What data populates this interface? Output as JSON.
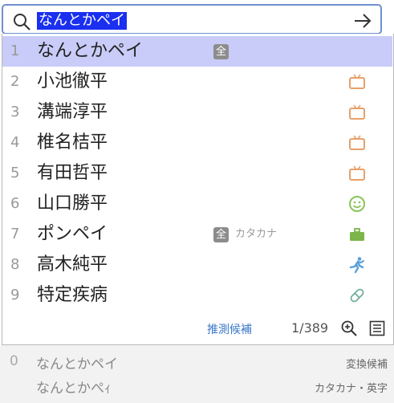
{
  "search": {
    "query": "なんとかペイ"
  },
  "candidates": [
    {
      "num": "1",
      "word": "なんとかペイ",
      "badge": "全",
      "icon": "full-width-badge"
    },
    {
      "num": "2",
      "word": "小池徹平",
      "icon": "tv-icon"
    },
    {
      "num": "3",
      "word": "溝端淳平",
      "icon": "tv-icon"
    },
    {
      "num": "4",
      "word": "椎名桔平",
      "icon": "tv-icon"
    },
    {
      "num": "5",
      "word": "有田哲平",
      "icon": "tv-icon"
    },
    {
      "num": "6",
      "word": "山口勝平",
      "icon": "smiley-icon"
    },
    {
      "num": "7",
      "word": "ポンペイ",
      "badge": "全",
      "note": "カタカナ",
      "icon": "briefcase-icon"
    },
    {
      "num": "8",
      "word": "高木純平",
      "icon": "runner-icon"
    },
    {
      "num": "9",
      "word": "特定疾病",
      "icon": "pill-icon"
    }
  ],
  "footer": {
    "link": "推測候補",
    "count": "1/389"
  },
  "conversion": {
    "num": "0",
    "line1": "なんとかペイ",
    "line2": "なんとかぺｨ",
    "label1": "変換候補",
    "label2": "カタカナ・英字"
  },
  "colors": {
    "highlight": "#c9ccf8",
    "query_bg": "#1a2ff0",
    "tv": "#e8a06a",
    "smiley": "#8cc35a",
    "briefcase": "#7cb54a",
    "runner": "#5a9fd8",
    "pill": "#6fb09a"
  }
}
